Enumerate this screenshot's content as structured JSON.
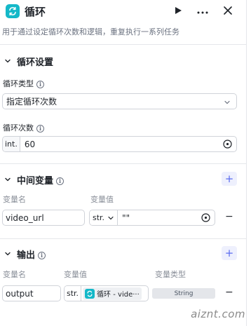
{
  "header": {
    "title": "循环",
    "icon": "loop-icon",
    "accent": "#14b8c8"
  },
  "description": "用于通过设定循环次数和逻辑，重复执行一系列任务",
  "loop_settings": {
    "title": "循环设置",
    "type_label": "循环类型",
    "type_value": "指定循环次数",
    "count_label": "循环次数",
    "count_type": "int.",
    "count_value": "60"
  },
  "intermediate": {
    "title": "中间变量",
    "col_name": "变量名",
    "col_value": "变量值",
    "row": {
      "name": "video_url",
      "type": "str.",
      "value": "\"\""
    }
  },
  "output": {
    "title": "输出",
    "col_name": "变量名",
    "col_value": "变量值",
    "col_type": "变量类型",
    "row": {
      "name": "output",
      "type": "str.",
      "ref_label": "循环 - vide···",
      "var_type": "String"
    }
  },
  "watermark": "aiznt.com"
}
